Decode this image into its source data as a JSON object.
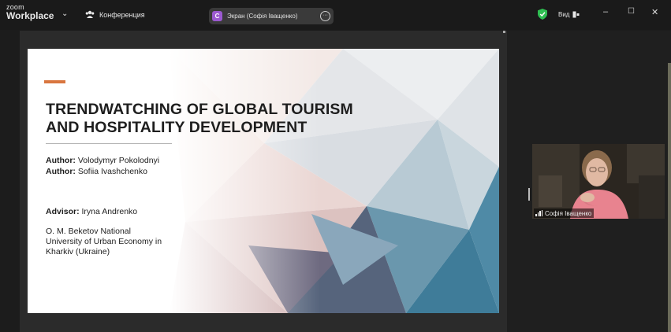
{
  "app": {
    "brand_top": "zoom",
    "brand_bottom": "Workplace"
  },
  "toolbar": {
    "conference_label": "Конференция",
    "screen_badge": "C",
    "screen_label": "Экран (Софія Іващенко)",
    "view_label": "Вид"
  },
  "slide": {
    "title_line1": "TRENDWATCHING OF GLOBAL TOURISM",
    "title_line2": "AND HOSPITALITY DEVELOPMENT",
    "author1_label": "Author:",
    "author1_name": "Volodymyr  Pokolodnyi",
    "author2_label": "Author:",
    "author2_name": "Sofiia Ivashchenko",
    "advisor_label": "Advisor:",
    "advisor_name": "Iryna Andrenko",
    "institution_line1": "O. M. Beketov National",
    "institution_line2": "University of Urban Economy in",
    "institution_line3": "Kharkiv (Ukraine)"
  },
  "participant": {
    "name": "Софія Іващенко"
  },
  "colors": {
    "accent": "#d9763f",
    "screen_badge": "#9b59d0",
    "shield": "#2fbf52"
  },
  "icons": [
    "participants-icon",
    "more-icon",
    "shield-icon",
    "view-icon",
    "minimize-icon",
    "maximize-icon",
    "close-icon",
    "signal-icon"
  ]
}
